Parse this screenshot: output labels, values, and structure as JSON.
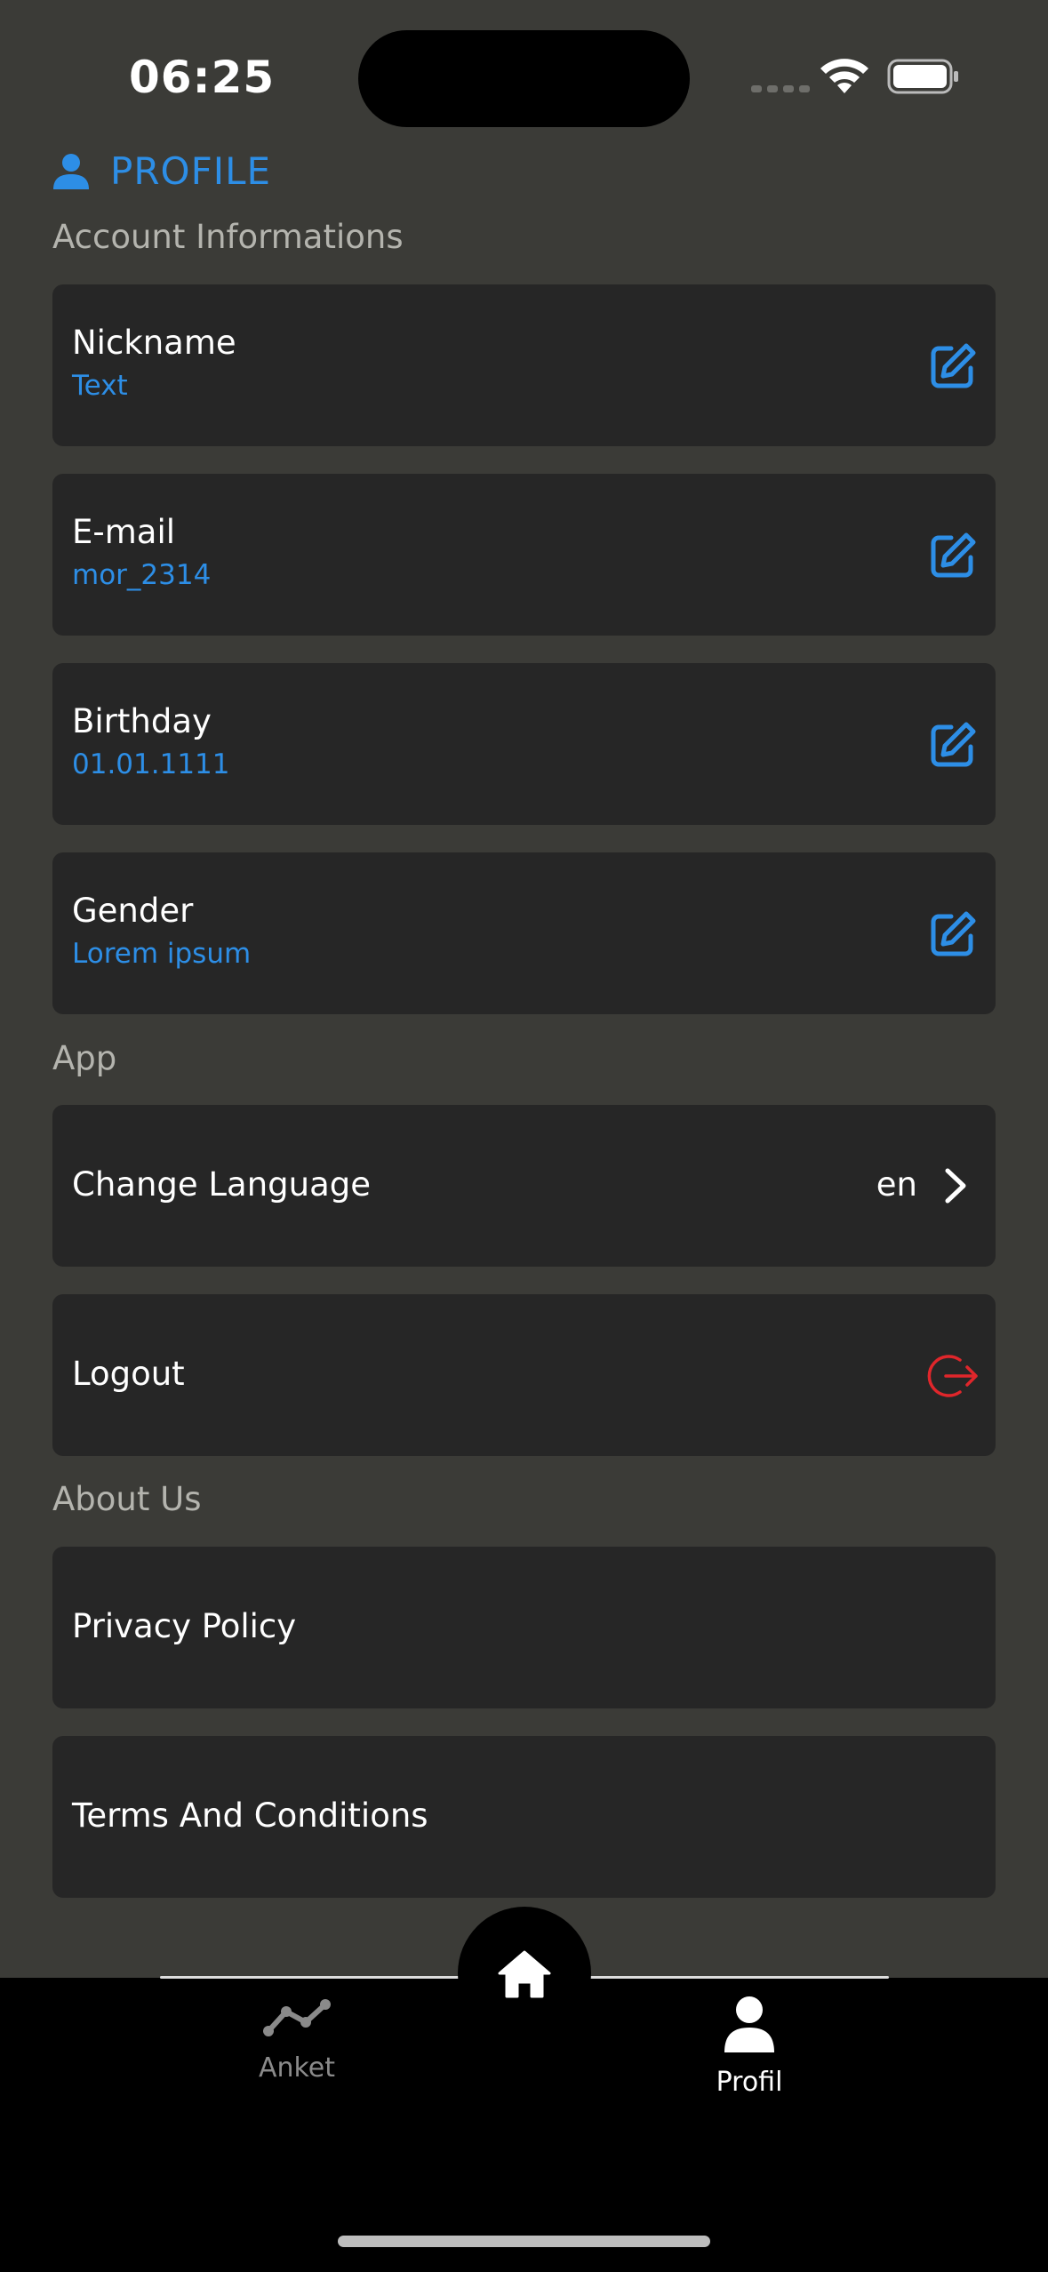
{
  "status_bar": {
    "time": "06:25"
  },
  "header": {
    "title": "PROFILE",
    "icon": "person-icon"
  },
  "sections": {
    "account": "Account Informations",
    "app": "App",
    "about": "About Us"
  },
  "account_items": [
    {
      "label": "Nickname",
      "value": "Text"
    },
    {
      "label": "E-mail",
      "value": "mor_2314"
    },
    {
      "label": "Birthday",
      "value": "01.01.1111"
    },
    {
      "label": "Gender",
      "value": "Lorem ipsum"
    }
  ],
  "app_items": {
    "language": {
      "label": "Change Language",
      "value": "en"
    },
    "logout": {
      "label": "Logout"
    }
  },
  "about_items": [
    {
      "label": "Privacy Policy"
    },
    {
      "label": "Terms And Conditions"
    }
  ],
  "tabbar": {
    "tabs": [
      {
        "label": "Anket",
        "icon": "line-chart-icon",
        "active": false
      },
      {
        "label": "Profil",
        "icon": "person-icon",
        "active": true
      }
    ],
    "center_icon": "home-icon"
  },
  "colors": {
    "background": "#3b3b37",
    "card": "#262626",
    "accent": "#2d8ee6",
    "danger": "#e0262b",
    "tabbar": "#000000"
  }
}
